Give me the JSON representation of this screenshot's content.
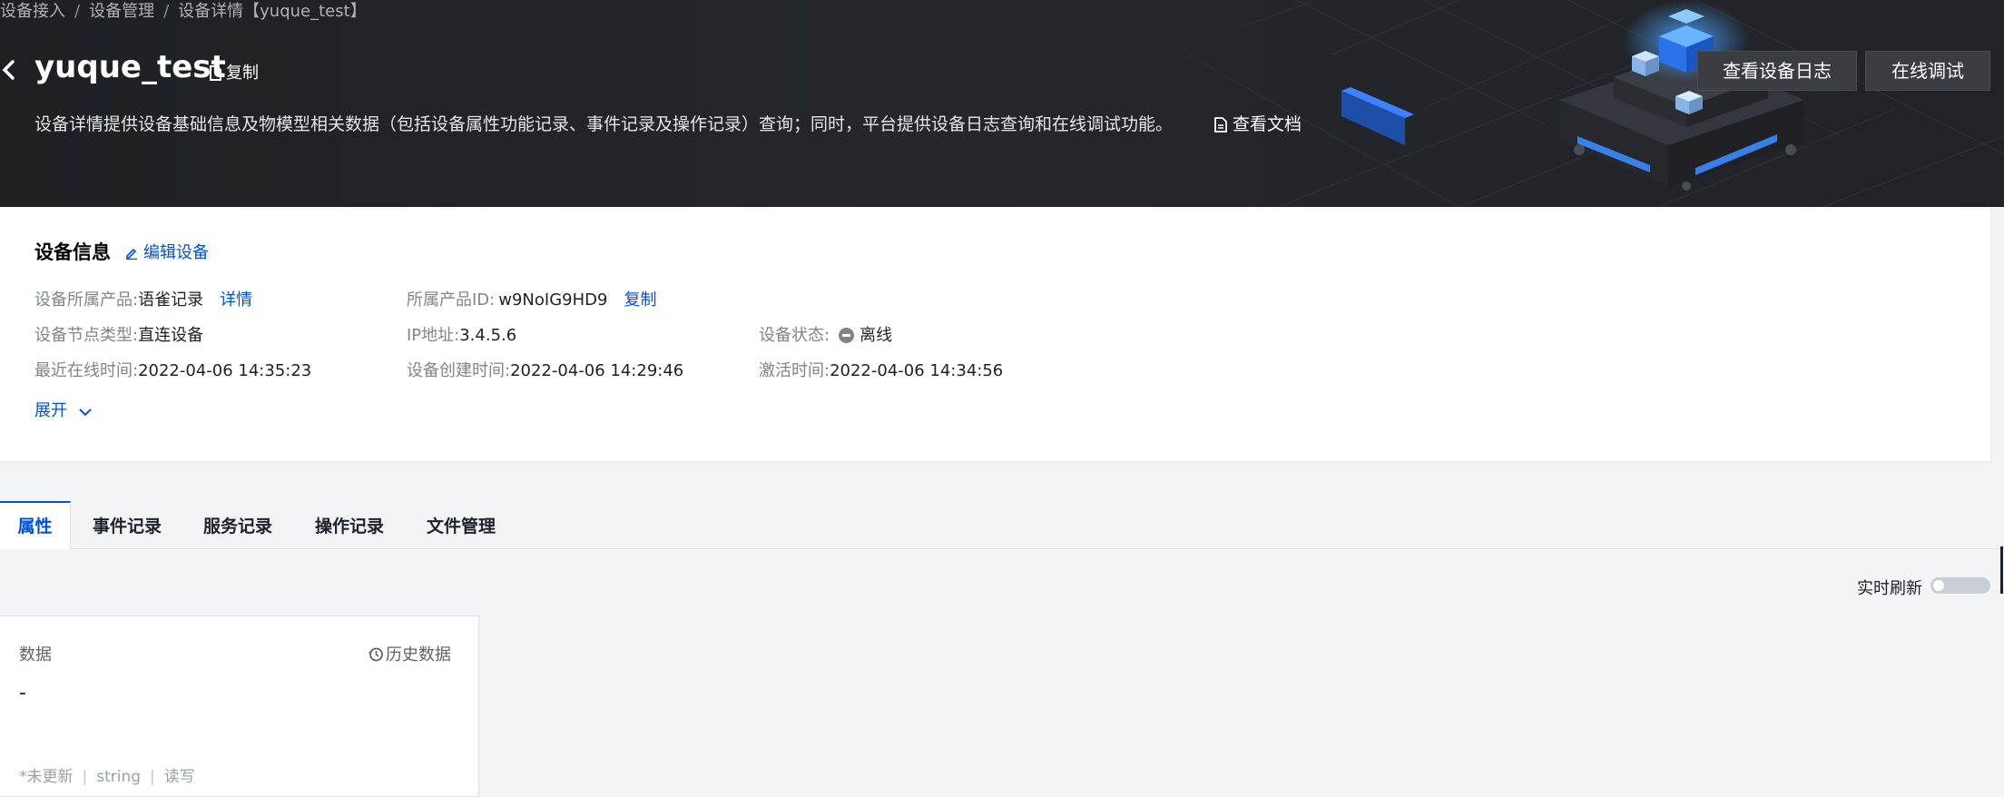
{
  "breadcrumb": {
    "items": [
      "设备接入",
      "设备管理",
      "设备详情【yuque_test】"
    ]
  },
  "header": {
    "title": "yuque_test",
    "copy_label": "复制",
    "description": "设备详情提供设备基础信息及物模型相关数据（包括设备属性功能记录、事件记录及操作记录）查询；同时，平台提供设备日志查询和在线调试功能。",
    "doc_link": "查看文档",
    "buttons": {
      "view_log": "查看设备日志",
      "online_debug": "在线调试"
    }
  },
  "device_info": {
    "title": "设备信息",
    "edit_label": "编辑设备",
    "product": {
      "label": "设备所属产品:",
      "value": "语雀记录",
      "link": "详情"
    },
    "product_id": {
      "label": "所属产品ID:",
      "value": "w9NoIG9HD9",
      "link": "复制"
    },
    "node_type": {
      "label": "设备节点类型:",
      "value": "直连设备"
    },
    "ip": {
      "label": "IP地址:",
      "value": "3.4.5.6"
    },
    "status": {
      "label": "设备状态:",
      "value": "离线"
    },
    "last_online": {
      "label": "最近在线时间:",
      "value": "2022-04-06 14:35:23"
    },
    "created": {
      "label": "设备创建时间:",
      "value": "2022-04-06 14:29:46"
    },
    "activated": {
      "label": "激活时间:",
      "value": "2022-04-06 14:34:56"
    },
    "expand_label": "展开"
  },
  "tabs": [
    {
      "label": "属性",
      "active": true
    },
    {
      "label": "事件记录",
      "active": false
    },
    {
      "label": "服务记录",
      "active": false
    },
    {
      "label": "操作记录",
      "active": false
    },
    {
      "label": "文件管理",
      "active": false
    }
  ],
  "realtime": {
    "label": "实时刷新",
    "enabled": false
  },
  "property": {
    "name": "数据",
    "history_label": "历史数据",
    "value": "-",
    "meta": [
      "*未更新",
      "string",
      "读写"
    ]
  },
  "colors": {
    "accent": "#0052d9",
    "banner_bg": "#202327",
    "offline": "#7f8489"
  }
}
